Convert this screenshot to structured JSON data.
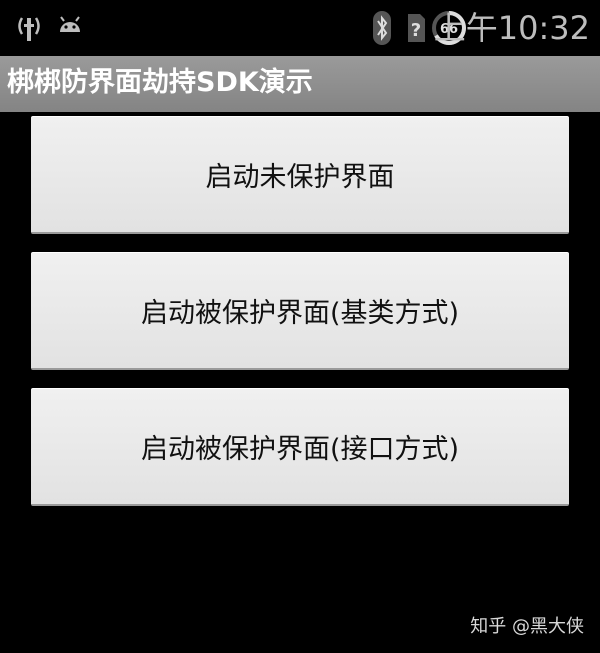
{
  "status_bar": {
    "time": "上午10:32",
    "battery_level": "66",
    "icons": [
      "usb-debug-icon",
      "android-icon",
      "bluetooth-icon",
      "no-sim-icon",
      "battery-icon"
    ]
  },
  "app": {
    "title": "梆梆防界面劫持SDK演示"
  },
  "buttons": {
    "launch_unprotected": "启动未保护界面",
    "launch_protected_base": "启动被保护界面(基类方式)",
    "launch_protected_interface": "启动被保护界面(接口方式)"
  },
  "watermark": {
    "text": "知乎 @黑大侠"
  },
  "colors": {
    "background": "#000000",
    "title_bar": "#8f8f8f",
    "button": "#e8e8e8",
    "status_text": "#bdbdbd"
  }
}
